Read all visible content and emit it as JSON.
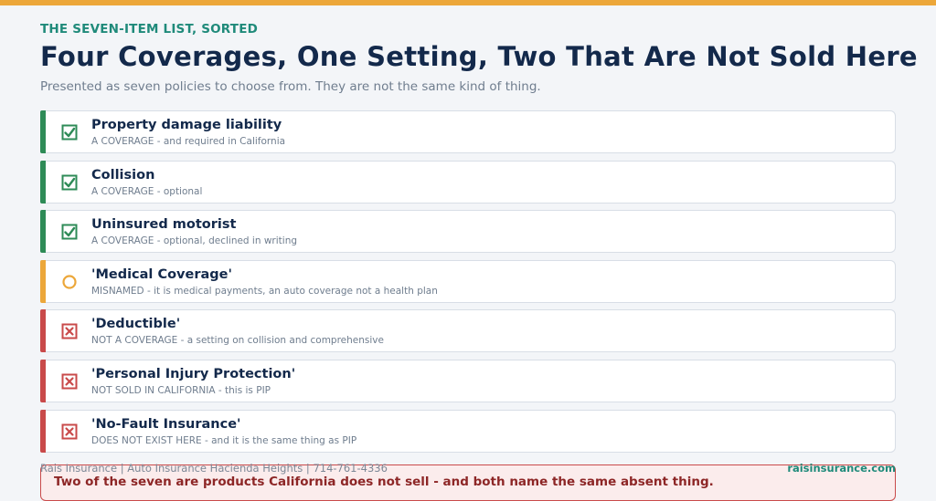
{
  "header": {
    "eyebrow": "THE SEVEN-ITEM LIST, SORTED",
    "title": "Four Coverages, One Setting, Two That Are Not Sold Here",
    "subtitle": "Presented as seven policies to choose from. They are not the same kind of thing."
  },
  "colors": {
    "top_bar": "#eca73a",
    "coverage": "#2e8b57",
    "misnamed": "#eca73a",
    "not_coverage": "#c94a4a"
  },
  "items": [
    {
      "name": "Property damage liability",
      "desc": "A COVERAGE - and required in California",
      "status": "coverage",
      "icon": "checked-box-icon"
    },
    {
      "name": "Collision",
      "desc": "A COVERAGE - optional",
      "status": "coverage",
      "icon": "checked-box-icon"
    },
    {
      "name": "Uninsured motorist",
      "desc": "A COVERAGE - optional, declined in writing",
      "status": "coverage",
      "icon": "checked-box-icon"
    },
    {
      "name": "'Medical Coverage'",
      "desc": "MISNAMED - it is medical payments, an auto coverage not a health plan",
      "status": "misnamed",
      "icon": "circle-icon"
    },
    {
      "name": "'Deductible'",
      "desc": "NOT A COVERAGE - a setting on collision and comprehensive",
      "status": "not",
      "icon": "x-box-icon"
    },
    {
      "name": "'Personal Injury Protection'",
      "desc": "NOT SOLD IN CALIFORNIA - this is PIP",
      "status": "not",
      "icon": "x-box-icon"
    },
    {
      "name": "'No-Fault Insurance'",
      "desc": "DOES NOT EXIST HERE - and it is the same thing as PIP",
      "status": "not",
      "icon": "x-box-icon"
    }
  ],
  "footer": {
    "left": "Rais Insurance  |  Auto Insurance Hacienda Heights  |  714-761-4336",
    "right": "raisinsurance.com"
  },
  "callout": {
    "text": "Two of the seven are products California does not sell - and both name the same absent thing."
  }
}
